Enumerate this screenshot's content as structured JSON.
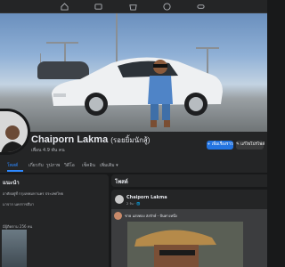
{
  "topnav": {
    "icons": [
      "home-icon",
      "video-icon",
      "marketplace-icon",
      "groups-icon",
      "gaming-icon"
    ]
  },
  "profile": {
    "name": "Chaiporn Lakma",
    "nickname": "(รอยยิ้มนักสู้)",
    "friends": "เพื่อน 4.9 พัน คน"
  },
  "buttons": {
    "add_story": "+ เพิ่มเรื่องราว",
    "edit_profile": "✎ แก้ไขโปรไฟล์"
  },
  "tabs": [
    "โพสต์",
    "เกี่ยวกับ",
    "รูปภาพ",
    "วิดีโอ",
    "เช็คอิน",
    "เพิ่มเติม ▾"
  ],
  "intro": {
    "title": "แนะนำ",
    "lines": [
      "อาศัยอยู่ที่ กรุงเทพมหานคร ประเทศไทย",
      "มาจาก นครราชสีมา",
      "มีผู้ติดตาม 256 คน"
    ]
  },
  "posts": {
    "header": "โพสต์",
    "author": "Chaiporn Lakma",
    "time": "2 วัน · 🌐",
    "shared_author": "ชาย แสงทอง ส่งรักษ์ - ปั่นทางหนึ่ง"
  },
  "colors": {
    "accent": "#2d88ff",
    "button_primary": "#2374e1",
    "background": "#18191a",
    "card": "#242526"
  }
}
